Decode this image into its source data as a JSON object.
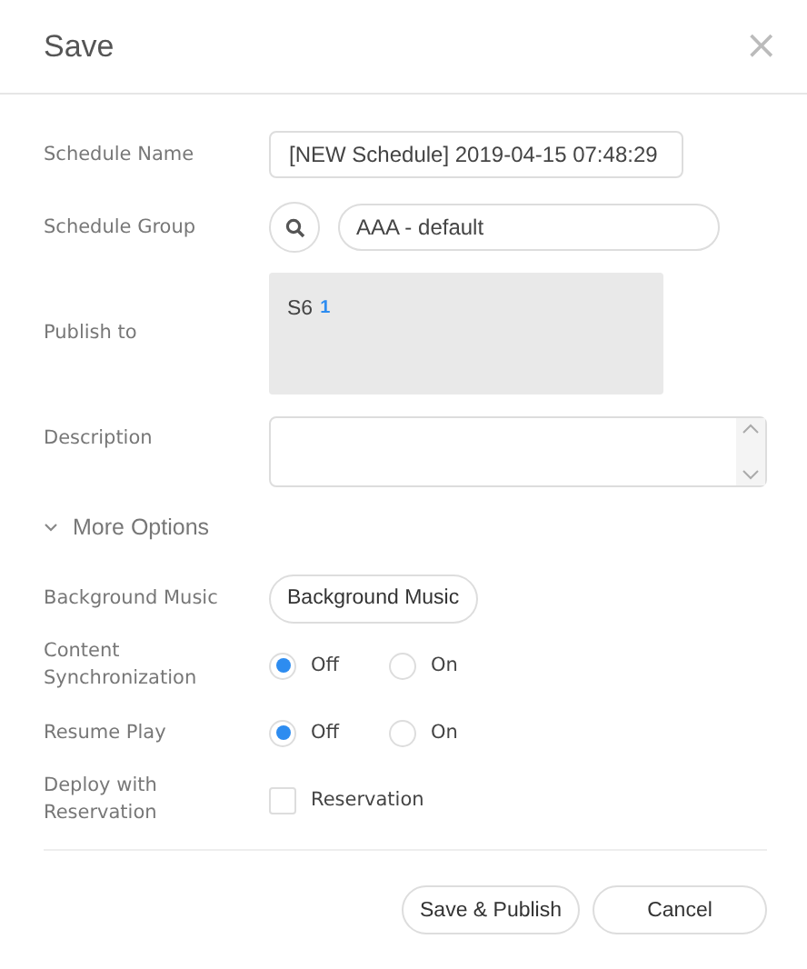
{
  "dialog": {
    "title": "Save",
    "close": "×"
  },
  "fields": [
    {
      "kind": "text",
      "label": "Schedule Name",
      "value": "[NEW Schedule] 2019-04-15 07:48:29"
    },
    {
      "kind": "group",
      "label": "Schedule Group",
      "value": "AAA - default"
    },
    {
      "kind": "publish",
      "label": "Publish to",
      "target": "S6",
      "count": "1"
    },
    {
      "kind": "textarea",
      "label": "Description"
    }
  ],
  "more_options": {
    "label": "More Options",
    "expanded": true
  },
  "options": [
    {
      "kind": "button",
      "label": "Background Music",
      "button": "Background Music"
    },
    {
      "kind": "radio",
      "label": "Content Synchronization",
      "choices": [
        {
          "label": "Off",
          "selected": true
        },
        {
          "label": "On",
          "selected": false
        }
      ]
    },
    {
      "kind": "radio",
      "label": "Resume Play",
      "choices": [
        {
          "label": "Off",
          "selected": true
        },
        {
          "label": "On",
          "selected": false
        }
      ]
    },
    {
      "kind": "checkbox",
      "label": "Deploy with Reservation",
      "text": "Reservation",
      "checked": false
    }
  ],
  "buttons": [
    "Save & Publish",
    "Cancel"
  ]
}
